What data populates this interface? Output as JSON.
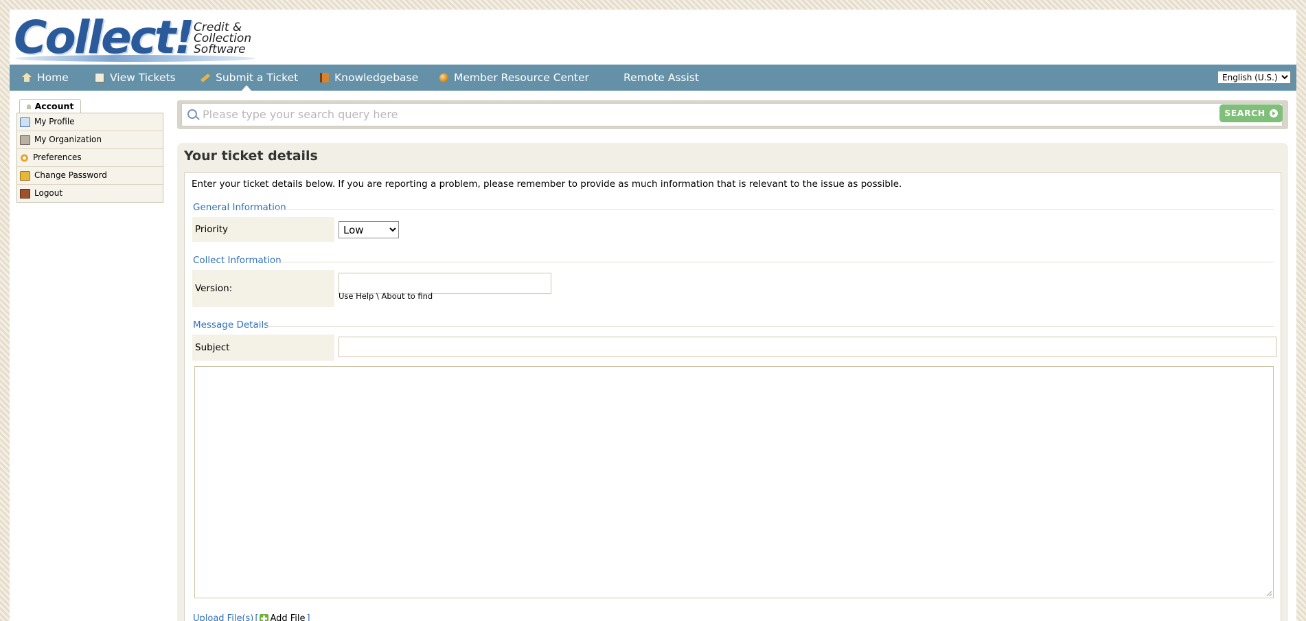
{
  "logo": {
    "wordmark": "Collect!",
    "tagline": "Credit &\nCollection\nSoftware"
  },
  "nav": {
    "items": [
      {
        "label": "Home",
        "icon": "home-icon"
      },
      {
        "label": "View Tickets",
        "icon": "tickets-icon"
      },
      {
        "label": "Submit a Ticket",
        "icon": "pencil-icon",
        "active": true
      },
      {
        "label": "Knowledgebase",
        "icon": "book-icon"
      },
      {
        "label": "Member Resource Center",
        "icon": "globe-icon"
      },
      {
        "label": "Remote Assist",
        "icon": ""
      }
    ],
    "language": "English (U.S.)",
    "bar_color": "#6591a8"
  },
  "sidebar": {
    "tab_label": "Account",
    "items": [
      {
        "label": "My Profile",
        "icon": "profile-icon"
      },
      {
        "label": "My Organization",
        "icon": "organization-icon"
      },
      {
        "label": "Preferences",
        "icon": "preferences-icon"
      },
      {
        "label": "Change Password",
        "icon": "lock-icon"
      },
      {
        "label": "Logout",
        "icon": "logout-icon"
      }
    ]
  },
  "search": {
    "placeholder": "Please type your search query here",
    "button_label": "SEARCH",
    "button_color": "#7fbf7a"
  },
  "main": {
    "title": "Your ticket details",
    "intro": "Enter your ticket details below. If you are reporting a problem, please remember to provide as much information that is relevant to the issue as possible.",
    "sections": {
      "general": "General Information",
      "collect": "Collect Information",
      "message": "Message Details"
    },
    "fields": {
      "priority_label": "Priority",
      "priority_value": "Low",
      "version_label": "Version:",
      "version_value": "",
      "version_hint": "Use Help \\ About to find",
      "subject_label": "Subject",
      "subject_value": "",
      "message_value": ""
    },
    "upload": {
      "label": "Upload File(s)",
      "open_bracket": "[",
      "add_label": "Add File",
      "close_bracket": "]"
    },
    "accent_color": "#2e70b8"
  }
}
